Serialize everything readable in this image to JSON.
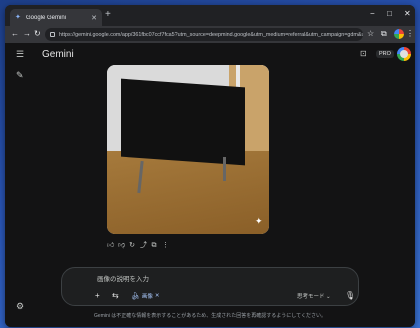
{
  "browser": {
    "tab_title": "Google Gemini",
    "url": "https://gemini.google.com/app/361fbc07ccf7fca5?utm_source=deepmind.google&utm_medium=referral&utm_campaign=gdm&utm_conte..."
  },
  "header": {
    "brand": "Gemini",
    "pro_badge": "PRO"
  },
  "image": {
    "description_icon": "sparkle-icon"
  },
  "response_actions": [
    "thumbs-up-icon",
    "thumbs-down-icon",
    "refresh-icon",
    "share-icon",
    "copy-icon",
    "more-icon"
  ],
  "composer": {
    "placeholder": "画像の説明を入力",
    "attachment_label": "画像",
    "mode_label": "思考モード"
  },
  "footer": {
    "disclaimer": "Gemini は不正確な情報を表示することがあるため、生成された回答を再確認するようにしてください。"
  },
  "colors": {
    "background": "#131314",
    "accent": "#a8c7fa"
  }
}
